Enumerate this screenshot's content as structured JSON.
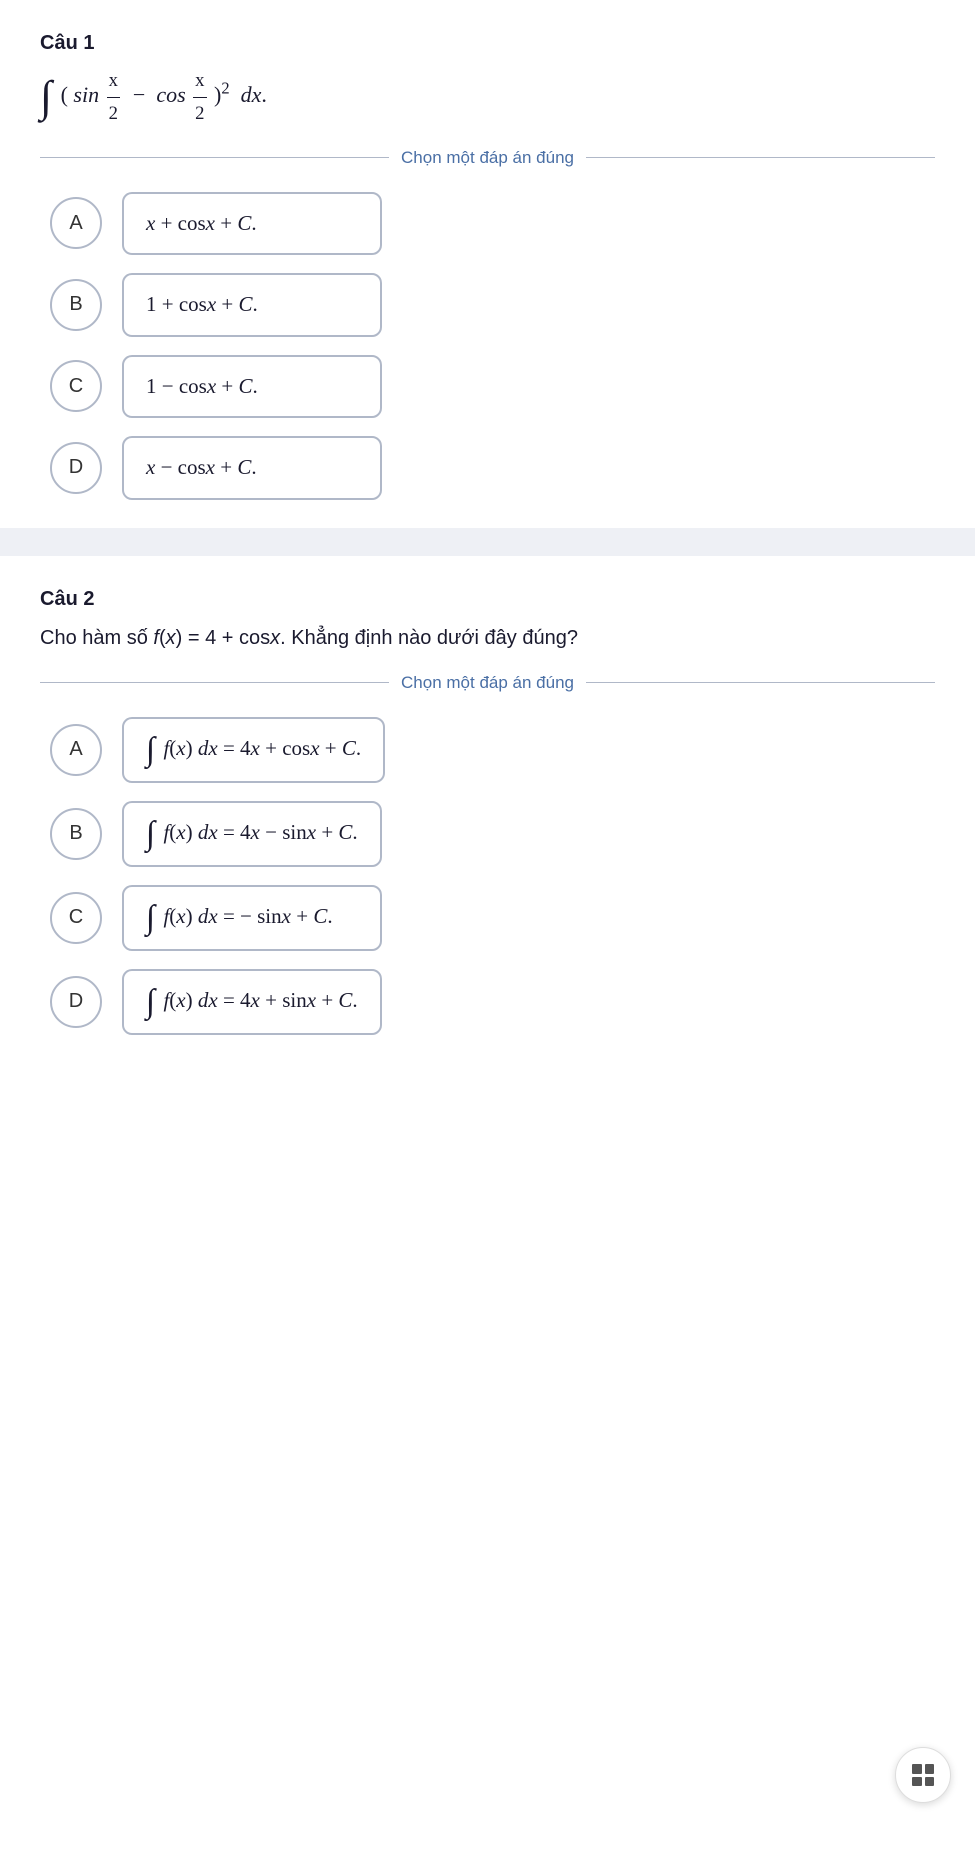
{
  "questions": [
    {
      "id": "cau1",
      "title": "Câu 1",
      "formula_desc": "integral of (sin x/2 - cos x/2)^2 dx",
      "divider_text": "Chọn một đáp án đúng",
      "options": [
        {
          "label": "A",
          "text": "x + cosx + C."
        },
        {
          "label": "B",
          "text": "1 + cosx + C."
        },
        {
          "label": "C",
          "text": "1 − cosx + C."
        },
        {
          "label": "D",
          "text": "x − cosx + C."
        }
      ]
    },
    {
      "id": "cau2",
      "title": "Câu 2",
      "description": "Cho hàm số f(x) = 4 + cosx. Khẳng định nào dưới đây đúng?",
      "divider_text": "Chọn một đáp án đúng",
      "options": [
        {
          "label": "A",
          "text": "∫ f(x) dx = 4x + cosx + C."
        },
        {
          "label": "B",
          "text": "∫ f(x) dx = 4x − sinx + C."
        },
        {
          "label": "C",
          "text": "∫ f(x) dx = − sinx + C."
        },
        {
          "label": "D",
          "text": "∫ f(x) dx = 4x + sinx + C."
        }
      ]
    }
  ],
  "fab": {
    "label": "grid-menu"
  }
}
